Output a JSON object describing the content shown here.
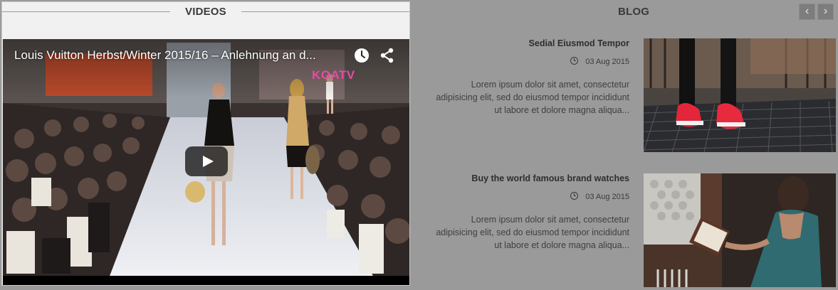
{
  "videos": {
    "heading": "VIDEOS",
    "video_title": "Louis Vuitton Herbst/Winter 2015/16 – Anlehnung an d...",
    "channel_logo": "KOATV",
    "watch_later_icon": "clock-icon",
    "share_icon": "share-icon",
    "play_icon": "play-icon"
  },
  "blog": {
    "heading": "BLOG",
    "prev_label": "‹",
    "next_label": "›",
    "posts": [
      {
        "title": "Sedial Eiusmod Tempor",
        "date": "03 Aug 2015",
        "excerpt": "Lorem ipsum dolor sit amet, consectetur adipisicing elit, sed do eiusmod tempor incididunt ut labore et dolore magna aliqua...",
        "image": "red-sneakers-on-grate-photo"
      },
      {
        "title": "Buy the world famous brand watches",
        "date": "03 Aug 2015",
        "excerpt": "Lorem ipsum dolor sit amet, consectetur adipisicing elit, sed do eiusmod tempor incididunt ut labore et dolore magna aliqua...",
        "image": "woman-reading-book-photo"
      }
    ]
  },
  "colors": {
    "page_background": "#9a9a9a",
    "videos_panel_background": "#f1f1f1",
    "heading_text": "#3a3a3a",
    "nav_button": "#7d7d7d"
  }
}
